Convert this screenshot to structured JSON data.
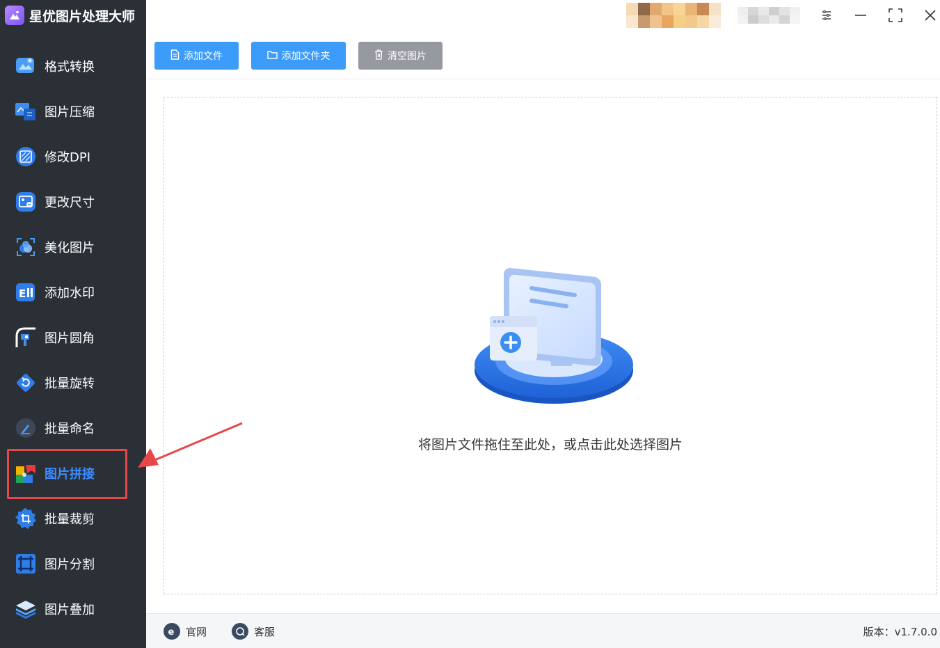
{
  "app": {
    "title": "星优图片处理大师",
    "logo_icon": "mountain-image-icon"
  },
  "sidebar": {
    "items": [
      {
        "label": "格式转换",
        "icon": "format-convert-icon"
      },
      {
        "label": "图片压缩",
        "icon": "image-compress-icon"
      },
      {
        "label": "修改DPI",
        "icon": "dpi-icon"
      },
      {
        "label": "更改尺寸",
        "icon": "resize-icon"
      },
      {
        "label": "美化图片",
        "icon": "beautify-icon"
      },
      {
        "label": "添加水印",
        "icon": "watermark-icon"
      },
      {
        "label": "图片圆角",
        "icon": "rounded-corner-icon"
      },
      {
        "label": "批量旋转",
        "icon": "rotate-icon"
      },
      {
        "label": "批量命名",
        "icon": "rename-icon"
      },
      {
        "label": "图片拼接",
        "icon": "puzzle-icon",
        "active": true
      },
      {
        "label": "批量裁剪",
        "icon": "crop-icon"
      },
      {
        "label": "图片分割",
        "icon": "split-icon"
      },
      {
        "label": "图片叠加",
        "icon": "layers-icon"
      }
    ]
  },
  "toolbar": {
    "add_file": "添加文件",
    "add_folder": "添加文件夹",
    "clear_images": "清空图片"
  },
  "dropzone": {
    "text": "将图片文件拖住至此处，或点击此处选择图片"
  },
  "statusbar": {
    "website": "官网",
    "support": "客服",
    "version": "版本：v1.7.0.0"
  },
  "colors": {
    "sidebar_bg": "#2b3037",
    "active_text": "#3d8dff",
    "primary_button": "#3d9bfa",
    "secondary_button": "#969aa0",
    "highlight": "#e8474a"
  }
}
